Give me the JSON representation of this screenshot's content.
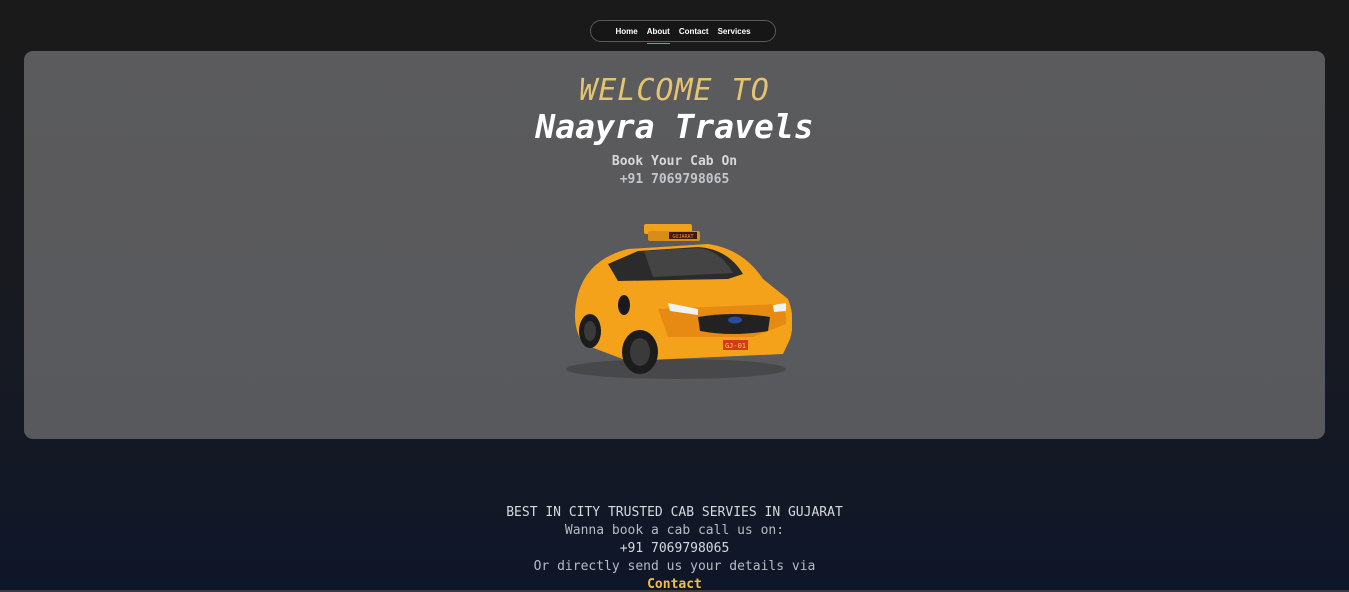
{
  "nav": {
    "items": [
      {
        "label": "Home"
      },
      {
        "label": "About"
      },
      {
        "label": "Contact"
      },
      {
        "label": "Services"
      }
    ]
  },
  "hero": {
    "welcome": "WELCOME TO",
    "brand": "Naayra Travels",
    "book_line": "Book Your Cab On",
    "phone": "+91 7069798065",
    "car_image": "yellow-taxi-car",
    "car_roof_sign": "GUJARAT",
    "car_plate": "GJ-01"
  },
  "info": {
    "headline": "BEST IN CITY TRUSTED CAB SERVIES IN GUJARAT",
    "call_line": "Wanna book a cab call us on:",
    "phone": "+91 7069798065",
    "details_line": "Or directly send us your details via",
    "contact_link": "Contact"
  },
  "colors": {
    "accent_yellow": "#e5c46f",
    "link_yellow": "#f0c23a",
    "hero_bg": "#5b5b5d",
    "page_bg": "#1a1a1a"
  }
}
